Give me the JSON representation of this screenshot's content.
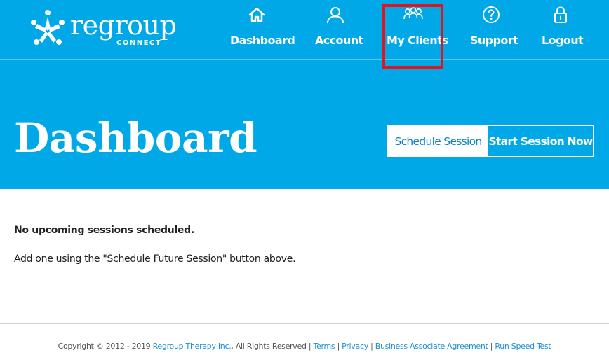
{
  "brand": {
    "name": "regroup",
    "subname": "CONNECT"
  },
  "nav": [
    {
      "label": "Dashboard",
      "icon": "home-icon"
    },
    {
      "label": "Account",
      "icon": "user-icon"
    },
    {
      "label": "My Clients",
      "icon": "group-icon"
    },
    {
      "label": "Support",
      "icon": "help-icon"
    },
    {
      "label": "Logout",
      "icon": "lock-icon"
    }
  ],
  "page": {
    "title": "Dashboard"
  },
  "actions": {
    "schedule": "Schedule Session",
    "start": "Start Session Now"
  },
  "content": {
    "no_sessions": "No upcoming sessions scheduled.",
    "hint": "Add one using the \"Schedule Future Session\" button above."
  },
  "footer": {
    "copyright": "Copyright © 2012 - 2019",
    "company": "Regroup Therapy Inc.",
    "rights": ", All Rights Reserved |",
    "sep": "|",
    "links": [
      "Terms",
      "Privacy",
      "Business Associate Agreement",
      "Run Speed Test"
    ]
  },
  "colors": {
    "brand_blue": "#00a8e8",
    "link_blue": "#1b8fd2",
    "highlight_red": "#e3141b"
  }
}
